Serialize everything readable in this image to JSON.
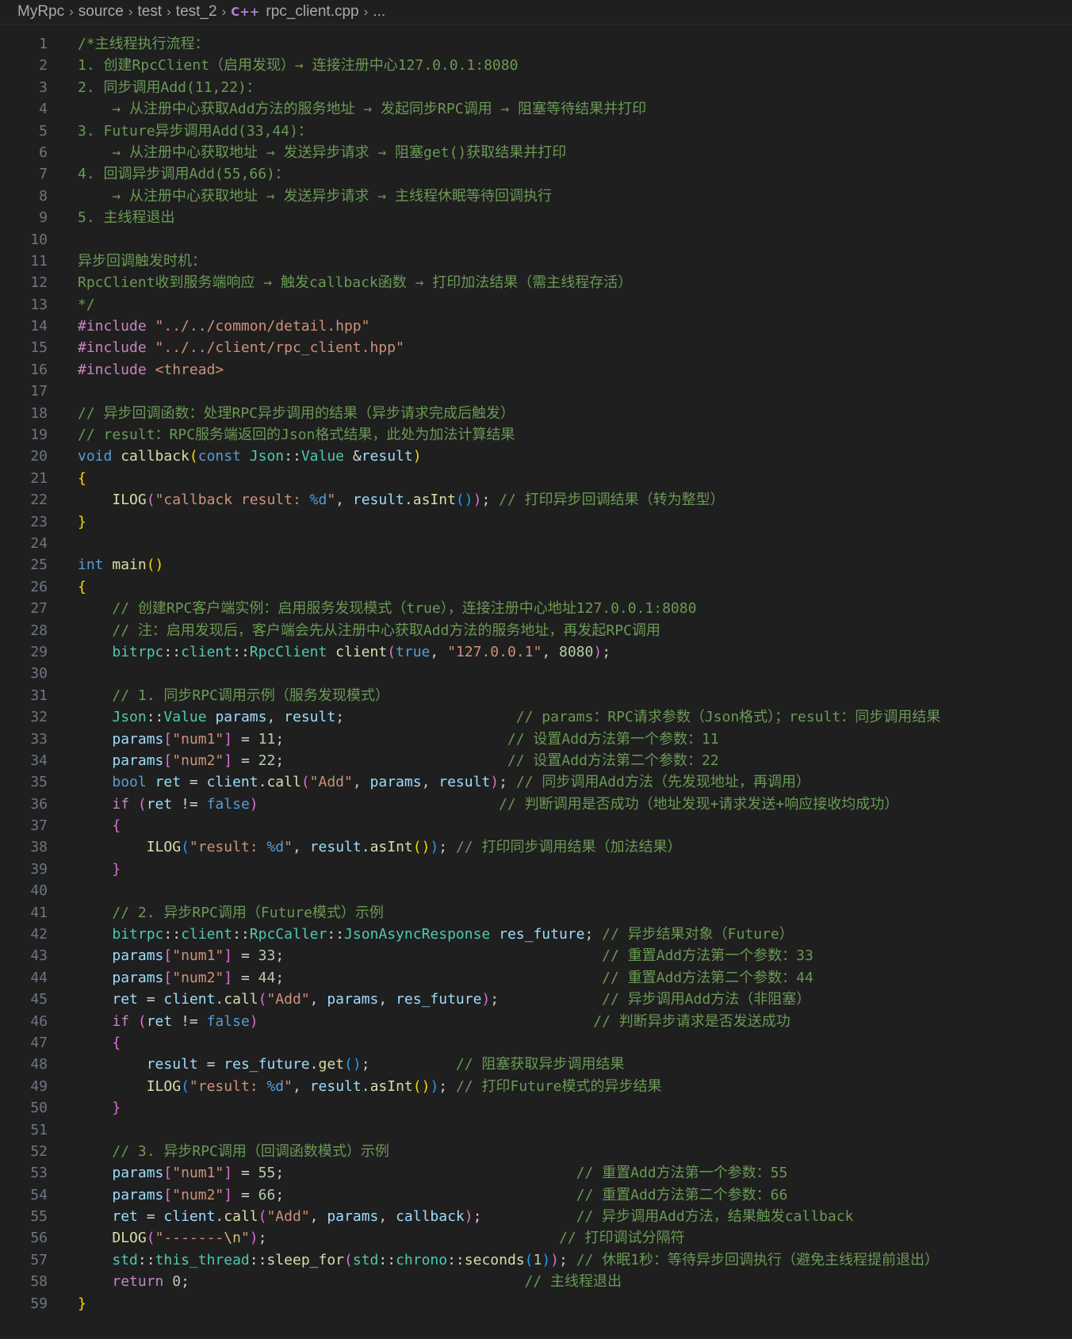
{
  "breadcrumb": {
    "items": [
      "MyRpc",
      "source",
      "test",
      "test_2",
      "rpc_client.cpp",
      "..."
    ],
    "file_icon": "C++"
  },
  "editor": {
    "lines": [
      [
        [
          "/*主线程执行流程：",
          "cm"
        ]
      ],
      [
        [
          "1. 创建RpcClient（启用发现）→ 连接注册中心127.0.0.1:8080",
          "cm"
        ]
      ],
      [
        [
          "2. 同步调用Add(11,22)：",
          "cm"
        ]
      ],
      [
        [
          "    ",
          "ws"
        ],
        [
          "→ 从注册中心获取Add方法的服务地址 → 发起同步RPC调用 → 阻塞等待结果并打印",
          "cm"
        ]
      ],
      [
        [
          "3. Future异步调用Add(33,44)：",
          "cm"
        ]
      ],
      [
        [
          "    ",
          "ws"
        ],
        [
          "→ 从注册中心获取地址 → 发送异步请求 → 阻塞get()获取结果并打印",
          "cm"
        ]
      ],
      [
        [
          "4. 回调异步调用Add(55,66)：",
          "cm"
        ]
      ],
      [
        [
          "    ",
          "ws"
        ],
        [
          "→ 从注册中心获取地址 → 发送异步请求 → 主线程休眠等待回调执行",
          "cm"
        ]
      ],
      [
        [
          "5. 主线程退出",
          "cm"
        ]
      ],
      [],
      [
        [
          "异步回调触发时机：",
          "cm"
        ]
      ],
      [
        [
          "RpcClient收到服务端响应 → 触发callback函数 → 打印加法结果（需主线程存活）",
          "cm"
        ]
      ],
      [
        [
          "*/",
          "cm"
        ]
      ],
      [
        [
          "#include ",
          "pp"
        ],
        [
          "\"../../common/detail.hpp\"",
          "st"
        ]
      ],
      [
        [
          "#include ",
          "pp"
        ],
        [
          "\"../../client/rpc_client.hpp\"",
          "st"
        ]
      ],
      [
        [
          "#include ",
          "pp"
        ],
        [
          "<thread>",
          "st"
        ]
      ],
      [],
      [
        [
          "// 异步回调函数：处理RPC异步调用的结果（异步请求完成后触发）",
          "cm"
        ]
      ],
      [
        [
          "// result：RPC服务端返回的Json格式结果，此处为加法计算结果",
          "cm"
        ]
      ],
      [
        [
          "void ",
          "kw"
        ],
        [
          "callback",
          "fn"
        ],
        [
          "(",
          "b1"
        ],
        [
          "const ",
          "kw"
        ],
        [
          "Json",
          "ty"
        ],
        [
          "::",
          "op"
        ],
        [
          "Value ",
          "ty"
        ],
        [
          "&",
          "op"
        ],
        [
          "result",
          "va"
        ],
        [
          ")",
          "b1"
        ]
      ],
      [
        [
          "{",
          "b1"
        ]
      ],
      [
        [
          "    ",
          "ws"
        ],
        [
          "ILOG",
          "fn"
        ],
        [
          "(",
          "b2"
        ],
        [
          "\"callback result: ",
          "st"
        ],
        [
          "%d",
          "kw"
        ],
        [
          "\"",
          "st"
        ],
        [
          ", ",
          "pl"
        ],
        [
          "result",
          "va"
        ],
        [
          ".",
          "pl"
        ],
        [
          "asInt",
          "fn"
        ],
        [
          "()",
          "b3"
        ],
        [
          ")",
          "b2"
        ],
        [
          "; ",
          "pl"
        ],
        [
          "// 打印异步回调结果（转为整型）",
          "cm"
        ]
      ],
      [
        [
          "}",
          "b1"
        ]
      ],
      [],
      [
        [
          "int ",
          "kw"
        ],
        [
          "main",
          "fn"
        ],
        [
          "()",
          "b1"
        ]
      ],
      [
        [
          "{",
          "b1"
        ]
      ],
      [
        [
          "    ",
          "ws"
        ],
        [
          "// 创建RPC客户端实例：启用服务发现模式（true），连接注册中心地址127.0.0.1:8080",
          "cm"
        ]
      ],
      [
        [
          "    ",
          "ws"
        ],
        [
          "// 注：启用发现后，客户端会先从注册中心获取Add方法的服务地址，再发起RPC调用",
          "cm"
        ]
      ],
      [
        [
          "    ",
          "ws"
        ],
        [
          "bitrpc",
          "ty"
        ],
        [
          "::",
          "op"
        ],
        [
          "client",
          "ty"
        ],
        [
          "::",
          "op"
        ],
        [
          "RpcClient ",
          "ty"
        ],
        [
          "client",
          "fn"
        ],
        [
          "(",
          "b2"
        ],
        [
          "true",
          "kw"
        ],
        [
          ", ",
          "pl"
        ],
        [
          "\"127.0.0.1\"",
          "st"
        ],
        [
          ", ",
          "pl"
        ],
        [
          "8080",
          "nu"
        ],
        [
          ")",
          "b2"
        ],
        [
          ";",
          "pl"
        ]
      ],
      [],
      [
        [
          "    ",
          "ws"
        ],
        [
          "// 1. 同步RPC调用示例（服务发现模式）",
          "cm"
        ]
      ],
      [
        [
          "    ",
          "ws"
        ],
        [
          "Json",
          "ty"
        ],
        [
          "::",
          "op"
        ],
        [
          "Value ",
          "ty"
        ],
        [
          "params",
          "va"
        ],
        [
          ", ",
          "pl"
        ],
        [
          "result",
          "va"
        ],
        [
          ";",
          "pl"
        ],
        [
          "                    ",
          "ws"
        ],
        [
          "// params：RPC请求参数（Json格式）；result：同步调用结果",
          "cm"
        ]
      ],
      [
        [
          "    ",
          "ws"
        ],
        [
          "params",
          "va"
        ],
        [
          "[",
          "b2"
        ],
        [
          "\"num1\"",
          "st"
        ],
        [
          "]",
          "b2"
        ],
        [
          " = ",
          "op"
        ],
        [
          "11",
          "nu"
        ],
        [
          ";",
          "pl"
        ],
        [
          "                          ",
          "ws"
        ],
        [
          "// 设置Add方法第一个参数：11",
          "cm"
        ]
      ],
      [
        [
          "    ",
          "ws"
        ],
        [
          "params",
          "va"
        ],
        [
          "[",
          "b2"
        ],
        [
          "\"num2\"",
          "st"
        ],
        [
          "]",
          "b2"
        ],
        [
          " = ",
          "op"
        ],
        [
          "22",
          "nu"
        ],
        [
          ";",
          "pl"
        ],
        [
          "                          ",
          "ws"
        ],
        [
          "// 设置Add方法第二个参数：22",
          "cm"
        ]
      ],
      [
        [
          "    ",
          "ws"
        ],
        [
          "bool ",
          "kw"
        ],
        [
          "ret",
          "va"
        ],
        [
          " = ",
          "op"
        ],
        [
          "client",
          "va"
        ],
        [
          ".",
          "pl"
        ],
        [
          "call",
          "fn"
        ],
        [
          "(",
          "b2"
        ],
        [
          "\"Add\"",
          "st"
        ],
        [
          ", ",
          "pl"
        ],
        [
          "params",
          "va"
        ],
        [
          ", ",
          "pl"
        ],
        [
          "result",
          "va"
        ],
        [
          ")",
          "b2"
        ],
        [
          "; ",
          "pl"
        ],
        [
          "// 同步调用Add方法（先发现地址，再调用）",
          "cm"
        ]
      ],
      [
        [
          "    ",
          "ws"
        ],
        [
          "if ",
          "ctl"
        ],
        [
          "(",
          "b2"
        ],
        [
          "ret",
          "va"
        ],
        [
          " != ",
          "op"
        ],
        [
          "false",
          "kw"
        ],
        [
          ")",
          "b2"
        ],
        [
          "                            ",
          "ws"
        ],
        [
          "// 判断调用是否成功（地址发现+请求发送+响应接收均成功）",
          "cm"
        ]
      ],
      [
        [
          "    ",
          "ws"
        ],
        [
          "{",
          "b2"
        ]
      ],
      [
        [
          "    ",
          "ws"
        ],
        [
          "    ",
          "guide"
        ],
        [
          "ILOG",
          "fn"
        ],
        [
          "(",
          "b3"
        ],
        [
          "\"result: ",
          "st"
        ],
        [
          "%d",
          "kw"
        ],
        [
          "\"",
          "st"
        ],
        [
          ", ",
          "pl"
        ],
        [
          "result",
          "va"
        ],
        [
          ".",
          "pl"
        ],
        [
          "asInt",
          "fn"
        ],
        [
          "()",
          "b1"
        ],
        [
          ")",
          "b3"
        ],
        [
          "; ",
          "pl"
        ],
        [
          "// 打印同步调用结果（加法结果）",
          "cm"
        ]
      ],
      [
        [
          "    ",
          "ws"
        ],
        [
          "}",
          "b2"
        ]
      ],
      [],
      [
        [
          "    ",
          "ws"
        ],
        [
          "// 2. 异步RPC调用（Future模式）示例",
          "cm"
        ]
      ],
      [
        [
          "    ",
          "ws"
        ],
        [
          "bitrpc",
          "ty"
        ],
        [
          "::",
          "op"
        ],
        [
          "client",
          "ty"
        ],
        [
          "::",
          "op"
        ],
        [
          "RpcCaller",
          "ty"
        ],
        [
          "::",
          "op"
        ],
        [
          "JsonAsyncResponse ",
          "ty"
        ],
        [
          "res_future",
          "va"
        ],
        [
          "; ",
          "pl"
        ],
        [
          "// 异步结果对象（Future）",
          "cm"
        ]
      ],
      [
        [
          "    ",
          "ws"
        ],
        [
          "params",
          "va"
        ],
        [
          "[",
          "b2"
        ],
        [
          "\"num1\"",
          "st"
        ],
        [
          "]",
          "b2"
        ],
        [
          " = ",
          "op"
        ],
        [
          "33",
          "nu"
        ],
        [
          ";",
          "pl"
        ],
        [
          "                                     ",
          "ws"
        ],
        [
          "// 重置Add方法第一个参数：33",
          "cm"
        ]
      ],
      [
        [
          "    ",
          "ws"
        ],
        [
          "params",
          "va"
        ],
        [
          "[",
          "b2"
        ],
        [
          "\"num2\"",
          "st"
        ],
        [
          "]",
          "b2"
        ],
        [
          " = ",
          "op"
        ],
        [
          "44",
          "nu"
        ],
        [
          ";",
          "pl"
        ],
        [
          "                                     ",
          "ws"
        ],
        [
          "// 重置Add方法第二个参数：44",
          "cm"
        ]
      ],
      [
        [
          "    ",
          "ws"
        ],
        [
          "ret",
          "va"
        ],
        [
          " = ",
          "op"
        ],
        [
          "client",
          "va"
        ],
        [
          ".",
          "pl"
        ],
        [
          "call",
          "fn"
        ],
        [
          "(",
          "b2"
        ],
        [
          "\"Add\"",
          "st"
        ],
        [
          ", ",
          "pl"
        ],
        [
          "params",
          "va"
        ],
        [
          ", ",
          "pl"
        ],
        [
          "res_future",
          "va"
        ],
        [
          ")",
          "b2"
        ],
        [
          ";",
          "pl"
        ],
        [
          "            ",
          "ws"
        ],
        [
          "// 异步调用Add方法（非阻塞）",
          "cm"
        ]
      ],
      [
        [
          "    ",
          "ws"
        ],
        [
          "if ",
          "ctl"
        ],
        [
          "(",
          "b2"
        ],
        [
          "ret",
          "va"
        ],
        [
          " != ",
          "op"
        ],
        [
          "false",
          "kw"
        ],
        [
          ")",
          "b2"
        ],
        [
          "                                       ",
          "ws"
        ],
        [
          "// 判断异步请求是否发送成功",
          "cm"
        ]
      ],
      [
        [
          "    ",
          "ws"
        ],
        [
          "{",
          "b2"
        ]
      ],
      [
        [
          "    ",
          "ws"
        ],
        [
          "    ",
          "guide"
        ],
        [
          "result",
          "va"
        ],
        [
          " = ",
          "op"
        ],
        [
          "res_future",
          "va"
        ],
        [
          ".",
          "pl"
        ],
        [
          "get",
          "fn"
        ],
        [
          "()",
          "b3"
        ],
        [
          ";",
          "pl"
        ],
        [
          "          ",
          "ws"
        ],
        [
          "// 阻塞获取异步调用结果",
          "cm"
        ]
      ],
      [
        [
          "    ",
          "ws"
        ],
        [
          "    ",
          "guide"
        ],
        [
          "ILOG",
          "fn"
        ],
        [
          "(",
          "b3"
        ],
        [
          "\"result: ",
          "st"
        ],
        [
          "%d",
          "kw"
        ],
        [
          "\"",
          "st"
        ],
        [
          ", ",
          "pl"
        ],
        [
          "result",
          "va"
        ],
        [
          ".",
          "pl"
        ],
        [
          "asInt",
          "fn"
        ],
        [
          "()",
          "b1"
        ],
        [
          ")",
          "b3"
        ],
        [
          "; ",
          "pl"
        ],
        [
          "// 打印Future模式的异步结果",
          "cm"
        ]
      ],
      [
        [
          "    ",
          "ws"
        ],
        [
          "}",
          "b2"
        ]
      ],
      [],
      [
        [
          "    ",
          "ws"
        ],
        [
          "// 3. 异步RPC调用（回调函数模式）示例",
          "cm"
        ]
      ],
      [
        [
          "    ",
          "ws"
        ],
        [
          "params",
          "va"
        ],
        [
          "[",
          "b2"
        ],
        [
          "\"num1\"",
          "st"
        ],
        [
          "]",
          "b2"
        ],
        [
          " = ",
          "op"
        ],
        [
          "55",
          "nu"
        ],
        [
          ";",
          "pl"
        ],
        [
          "                                  ",
          "ws"
        ],
        [
          "// 重置Add方法第一个参数：55",
          "cm"
        ]
      ],
      [
        [
          "    ",
          "ws"
        ],
        [
          "params",
          "va"
        ],
        [
          "[",
          "b2"
        ],
        [
          "\"num2\"",
          "st"
        ],
        [
          "]",
          "b2"
        ],
        [
          " = ",
          "op"
        ],
        [
          "66",
          "nu"
        ],
        [
          ";",
          "pl"
        ],
        [
          "                                  ",
          "ws"
        ],
        [
          "// 重置Add方法第二个参数：66",
          "cm"
        ]
      ],
      [
        [
          "    ",
          "ws"
        ],
        [
          "ret",
          "va"
        ],
        [
          " = ",
          "op"
        ],
        [
          "client",
          "va"
        ],
        [
          ".",
          "pl"
        ],
        [
          "call",
          "fn"
        ],
        [
          "(",
          "b2"
        ],
        [
          "\"Add\"",
          "st"
        ],
        [
          ", ",
          "pl"
        ],
        [
          "params",
          "va"
        ],
        [
          ", ",
          "pl"
        ],
        [
          "callback",
          "va"
        ],
        [
          ")",
          "b2"
        ],
        [
          ";",
          "pl"
        ],
        [
          "           ",
          "ws"
        ],
        [
          "// 异步调用Add方法，结果触发callback",
          "cm"
        ]
      ],
      [
        [
          "    ",
          "ws"
        ],
        [
          "DLOG",
          "fn"
        ],
        [
          "(",
          "b2"
        ],
        [
          "\"-------",
          "st"
        ],
        [
          "\\n",
          "esc"
        ],
        [
          "\"",
          "st"
        ],
        [
          ")",
          "b2"
        ],
        [
          ";",
          "pl"
        ],
        [
          "                                  ",
          "ws"
        ],
        [
          "// 打印调试分隔符",
          "cm"
        ]
      ],
      [
        [
          "    ",
          "ws"
        ],
        [
          "std",
          "ty"
        ],
        [
          "::",
          "op"
        ],
        [
          "this_thread",
          "ty"
        ],
        [
          "::",
          "op"
        ],
        [
          "sleep_for",
          "fn"
        ],
        [
          "(",
          "b2"
        ],
        [
          "std",
          "ty"
        ],
        [
          "::",
          "op"
        ],
        [
          "chrono",
          "ty"
        ],
        [
          "::",
          "op"
        ],
        [
          "seconds",
          "fn"
        ],
        [
          "(",
          "b3"
        ],
        [
          "1",
          "nu"
        ],
        [
          ")",
          "b3"
        ],
        [
          ")",
          "b2"
        ],
        [
          "; ",
          "pl"
        ],
        [
          "// 休眠1秒：等待异步回调执行（避免主线程提前退出）",
          "cm"
        ]
      ],
      [
        [
          "    ",
          "ws"
        ],
        [
          "return ",
          "ctl"
        ],
        [
          "0",
          "nu"
        ],
        [
          ";",
          "pl"
        ],
        [
          "                                       ",
          "ws"
        ],
        [
          "// 主线程退出",
          "cm"
        ]
      ],
      [
        [
          "}",
          "b1"
        ]
      ]
    ]
  }
}
